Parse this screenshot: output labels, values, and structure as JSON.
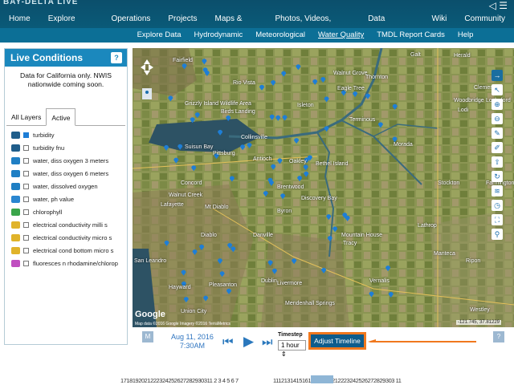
{
  "header": {
    "logo": "BAY-DELTA LIVE",
    "nav": [
      "Home",
      "Explore Data",
      "Operations",
      "Projects",
      "Maps & GIS",
      "Photos, Videos, Docs",
      "Data Catalog",
      "Wiki",
      "Community"
    ]
  },
  "subnav": {
    "items": [
      "Explore Data",
      "Hydrodynamic",
      "Meteorological",
      "Water Quality",
      "TMDL Report Cards",
      "Help"
    ],
    "active": "Water Quality"
  },
  "panel": {
    "title": "Live Conditions",
    "help": "?",
    "note": "Data for California only. NWIS nationwide coming soon.",
    "tabs": [
      "All Layers",
      "Active"
    ],
    "layers": [
      {
        "label": "turbidity",
        "checked": true,
        "icon_color": "#1f5d8a"
      },
      {
        "label": "turbidity fnu",
        "checked": false,
        "icon_color": "#1f5d8a"
      },
      {
        "label": "water, diss oxygen 3 meters",
        "checked": false,
        "icon_color": "#1f7fc4"
      },
      {
        "label": "water, diss oxygen 6 meters",
        "checked": false,
        "icon_color": "#1f7fc4"
      },
      {
        "label": "water, dissolved oxygen",
        "checked": false,
        "icon_color": "#1f7fc4"
      },
      {
        "label": "water, ph value",
        "checked": false,
        "icon_color": "#2a86d0"
      },
      {
        "label": "chlorophyll",
        "checked": false,
        "icon_color": "#3aa54a"
      },
      {
        "label": "electrical conductivity milli s",
        "checked": false,
        "icon_color": "#e0b32a"
      },
      {
        "label": "electrical conductivity micro s",
        "checked": false,
        "icon_color": "#e0b32a"
      },
      {
        "label": "electrical cond bottom micro s",
        "checked": false,
        "icon_color": "#e0b32a"
      },
      {
        "label": "fluoresces n rhodamine/chlorop",
        "checked": false,
        "icon_color": "#c04fc0"
      }
    ]
  },
  "map": {
    "places": [
      {
        "name": "Fairfield"
      },
      {
        "name": "Rio Vista"
      },
      {
        "name": "Walnut Grove"
      },
      {
        "name": "Thornton"
      },
      {
        "name": "Galt"
      },
      {
        "name": "Herald"
      },
      {
        "name": "Eagle Tree"
      },
      {
        "name": "Clements"
      },
      {
        "name": "Woodbridge"
      },
      {
        "name": "Lodi"
      },
      {
        "name": "Lockeford"
      },
      {
        "name": "Grizzly Island Wildlife Area"
      },
      {
        "name": "Isleton"
      },
      {
        "name": "Birds Landing"
      },
      {
        "name": "Collinsville"
      },
      {
        "name": "Terminous"
      },
      {
        "name": "Suisun Bay"
      },
      {
        "name": "Pittsburg"
      },
      {
        "name": "Antioch"
      },
      {
        "name": "Oakley"
      },
      {
        "name": "Bethel Island"
      },
      {
        "name": "Concord"
      },
      {
        "name": "Brentwood"
      },
      {
        "name": "Discovery Bay"
      },
      {
        "name": "Stockton"
      },
      {
        "name": "Walnut Creek"
      },
      {
        "name": "Lafayette"
      },
      {
        "name": "Mt Diablo"
      },
      {
        "name": "Byron"
      },
      {
        "name": "Lathrop"
      },
      {
        "name": "Diablo"
      },
      {
        "name": "Danville"
      },
      {
        "name": "Tracy"
      },
      {
        "name": "Manteca"
      },
      {
        "name": "Mountain House"
      },
      {
        "name": "San Leandro"
      },
      {
        "name": "Dublin"
      },
      {
        "name": "Livermore"
      },
      {
        "name": "Pleasanton"
      },
      {
        "name": "Hayward"
      },
      {
        "name": "Union City"
      },
      {
        "name": "Ripon"
      },
      {
        "name": "Vernalis"
      },
      {
        "name": "Westley"
      },
      {
        "name": "Morada"
      },
      {
        "name": "Farmington"
      },
      {
        "name": "Mendenhall Springs"
      }
    ],
    "google": "Google",
    "attribution": "Map data ©2016 Google Imagery ©2016 TerraMetrics",
    "coords": "-121.745, 37.81229"
  },
  "timeline": {
    "m_badge": "M",
    "date": "Aug 11, 2016",
    "time": "7:30AM",
    "timestep_label": "Timestep",
    "timestep_value": "1 hour",
    "adjust_label": "Adjust Timeline",
    "help": "?",
    "ticks_left": "1718192021222324252627282930311 2 3 4 5 6 7",
    "ticks_right": "11121314151617181920212223242526272829303 11"
  },
  "colors": {
    "accent": "#f0781e",
    "brand": "#0c6f96",
    "marker": "#1e7ed6"
  }
}
